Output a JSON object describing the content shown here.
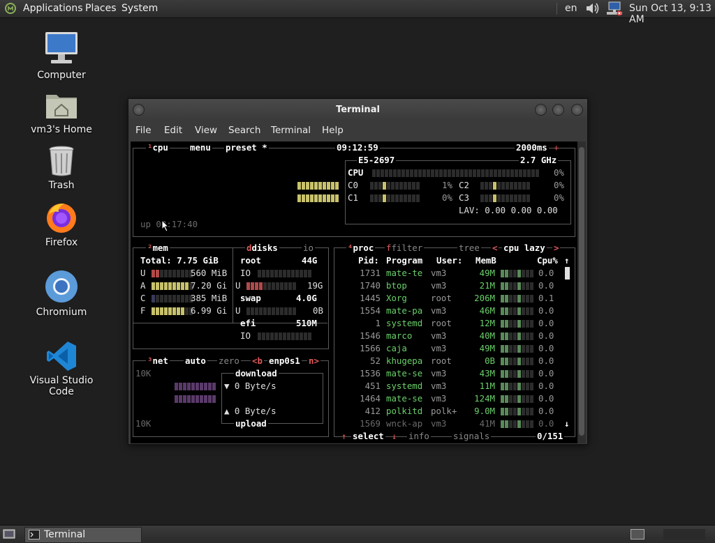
{
  "top_panel": {
    "applications": "Applications",
    "places": "Places",
    "system": "System",
    "lang": "en",
    "clock": "Sun Oct 13,  9:13 AM"
  },
  "desktop": {
    "computer": "Computer",
    "home": "vm3's Home",
    "trash": "Trash",
    "firefox": "Firefox",
    "chromium": "Chromium",
    "vscode": "Visual Studio Code"
  },
  "window": {
    "title": "Terminal",
    "menu": [
      "File",
      "Edit",
      "View",
      "Search",
      "Terminal",
      "Help"
    ]
  },
  "btop": {
    "cpu": {
      "num": "¹",
      "label": "cpu",
      "menu": "menu",
      "preset": "preset *",
      "time": "09:12:59",
      "interval": "2000ms",
      "plus": "+",
      "model": "E5-2697",
      "freq": "2.7 GHz",
      "total_label": "CPU",
      "total_pct": "0%",
      "c0": "C0",
      "c0_pct": "1%",
      "c1": "C1",
      "c1_pct": "0%",
      "c2": "C2",
      "c2_pct": "0%",
      "c3": "C3",
      "c3_pct": "0%",
      "lav": "LAV: 0.00 0.00 0.00",
      "uptime": "up 00:17:40"
    },
    "mem": {
      "num": "²",
      "label": "mem",
      "total": "Total: 7.75 GiB",
      "rows": [
        {
          "k": "U",
          "v": "560 MiB"
        },
        {
          "k": "A",
          "v": "7.20 Gi"
        },
        {
          "k": "C",
          "v": "385 MiB"
        },
        {
          "k": "F",
          "v": "6.99 Gi"
        }
      ]
    },
    "disks": {
      "label": "disks",
      "io": "io",
      "root": "root",
      "root_size": "44G",
      "io_label": "IO",
      "u": "U",
      "root_used": "19G",
      "swap": "swap",
      "swap_size": "4.0G",
      "swap_used": "0B",
      "efi": "efi",
      "efi_size": "510M"
    },
    "net": {
      "num": "³",
      "label": "net",
      "auto": "auto",
      "zero": "zero",
      "b": "<b",
      "iface": "enp0s1",
      "n": "n>",
      "scale_top": "10K",
      "scale_bottom": "10K",
      "download": "download",
      "upload": "upload",
      "down_rate": "▼ 0 Byte/s",
      "up_rate": "▲ 0 Byte/s"
    },
    "proc": {
      "num": "⁴",
      "label": "proc",
      "filter": "filter",
      "tree": "tree",
      "sort_left": "<",
      "sort": "cpu lazy",
      "sort_right": ">",
      "headers": [
        "Pid:",
        "Program",
        "User:",
        "MemB",
        "Cpu%"
      ],
      "rows": [
        {
          "pid": "1731",
          "prog": "mate-te",
          "user": "vm3",
          "mem": "49M",
          "cpu": "0.0"
        },
        {
          "pid": "1740",
          "prog": "btop",
          "user": "vm3",
          "mem": "21M",
          "cpu": "0.0"
        },
        {
          "pid": "1445",
          "prog": "Xorg",
          "user": "root",
          "mem": "206M",
          "cpu": "0.1"
        },
        {
          "pid": "1554",
          "prog": "mate-pa",
          "user": "vm3",
          "mem": "46M",
          "cpu": "0.0"
        },
        {
          "pid": "1",
          "prog": "systemd",
          "user": "root",
          "mem": "12M",
          "cpu": "0.0"
        },
        {
          "pid": "1546",
          "prog": "marco",
          "user": "vm3",
          "mem": "40M",
          "cpu": "0.0"
        },
        {
          "pid": "1566",
          "prog": "caja",
          "user": "vm3",
          "mem": "49M",
          "cpu": "0.0"
        },
        {
          "pid": "52",
          "prog": "khugepa",
          "user": "root",
          "mem": "0B",
          "cpu": "0.0"
        },
        {
          "pid": "1536",
          "prog": "mate-se",
          "user": "vm3",
          "mem": "43M",
          "cpu": "0.0"
        },
        {
          "pid": "451",
          "prog": "systemd",
          "user": "vm3",
          "mem": "11M",
          "cpu": "0.0"
        },
        {
          "pid": "1464",
          "prog": "mate-se",
          "user": "vm3",
          "mem": "124M",
          "cpu": "0.0"
        },
        {
          "pid": "412",
          "prog": "polkitd",
          "user": "polk+",
          "mem": "9.0M",
          "cpu": "0.0"
        },
        {
          "pid": "1569",
          "prog": "wnck-ap",
          "user": "vm3",
          "mem": "41M",
          "cpu": "0.0"
        }
      ],
      "up_arrow": "↑",
      "down_arrow": "↓",
      "select": "select",
      "sel_up": "↑",
      "sel_down": "↓",
      "info": "info",
      "signals": "signals",
      "count": "0/151"
    }
  },
  "taskbar": {
    "terminal": "Terminal"
  },
  "colors": {
    "accent_red": "#e05a5a",
    "process_green": "#6ad06a",
    "meter_yellow": "#c9c26c"
  }
}
